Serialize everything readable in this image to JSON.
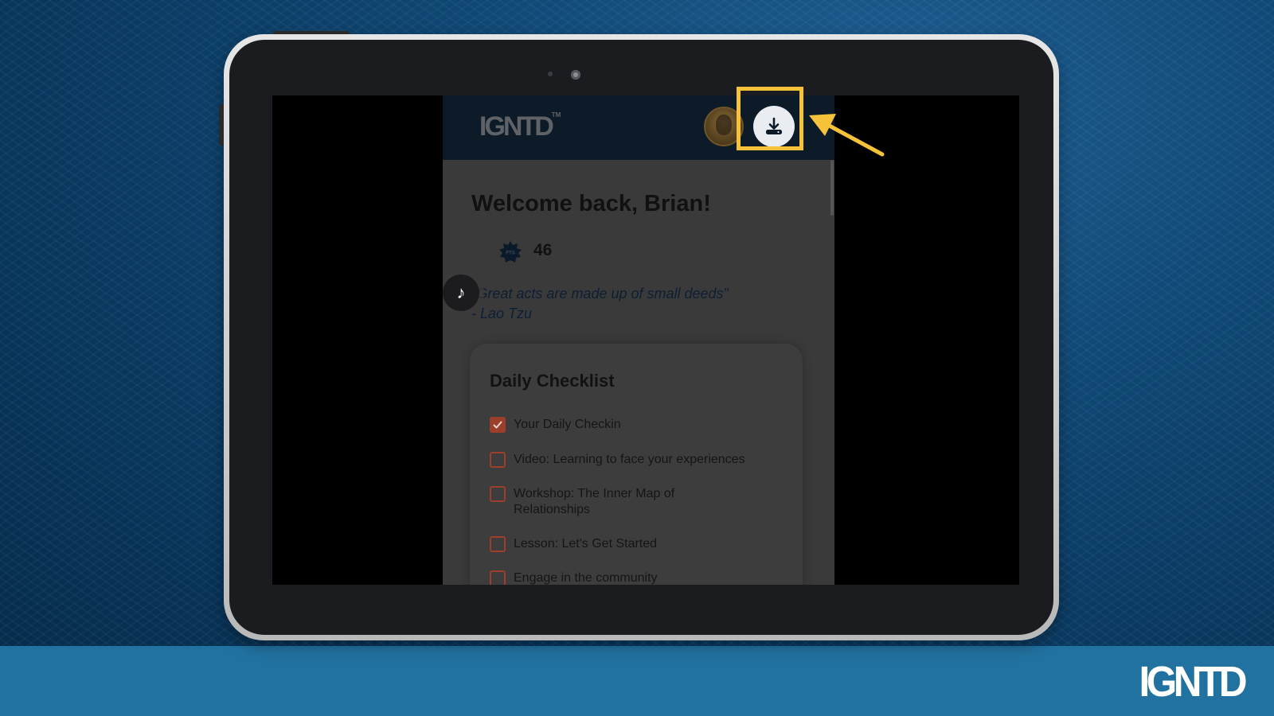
{
  "brand": {
    "footer_logo": "IGNTD",
    "app_logo": "IGNTD",
    "app_logo_tm": "TM"
  },
  "colors": {
    "accent": "#f5c23a",
    "checkbox": "#9b3f2a",
    "band": "#2272a1"
  },
  "header": {
    "avatar_icon": "user-avatar",
    "download_icon": "download-icon"
  },
  "welcome": {
    "title": "Welcome back, Brian!"
  },
  "points": {
    "badge_label": "PTS",
    "value": "46"
  },
  "quote": {
    "text": "\"Great acts are made up of small deeds\"",
    "author": "- Lao Tzu"
  },
  "tiktok_icon": "tiktok-icon",
  "checklist": {
    "title": "Daily Checklist",
    "items": [
      {
        "label": "Your Daily Checkin",
        "checked": true
      },
      {
        "label": "Video: Learning to face your experiences",
        "checked": false
      },
      {
        "label": "Workshop: The Inner Map of Relationships",
        "checked": false
      },
      {
        "label": "Lesson: Let's Get Started",
        "checked": false
      },
      {
        "label": "Engage in the community",
        "checked": false
      }
    ]
  }
}
